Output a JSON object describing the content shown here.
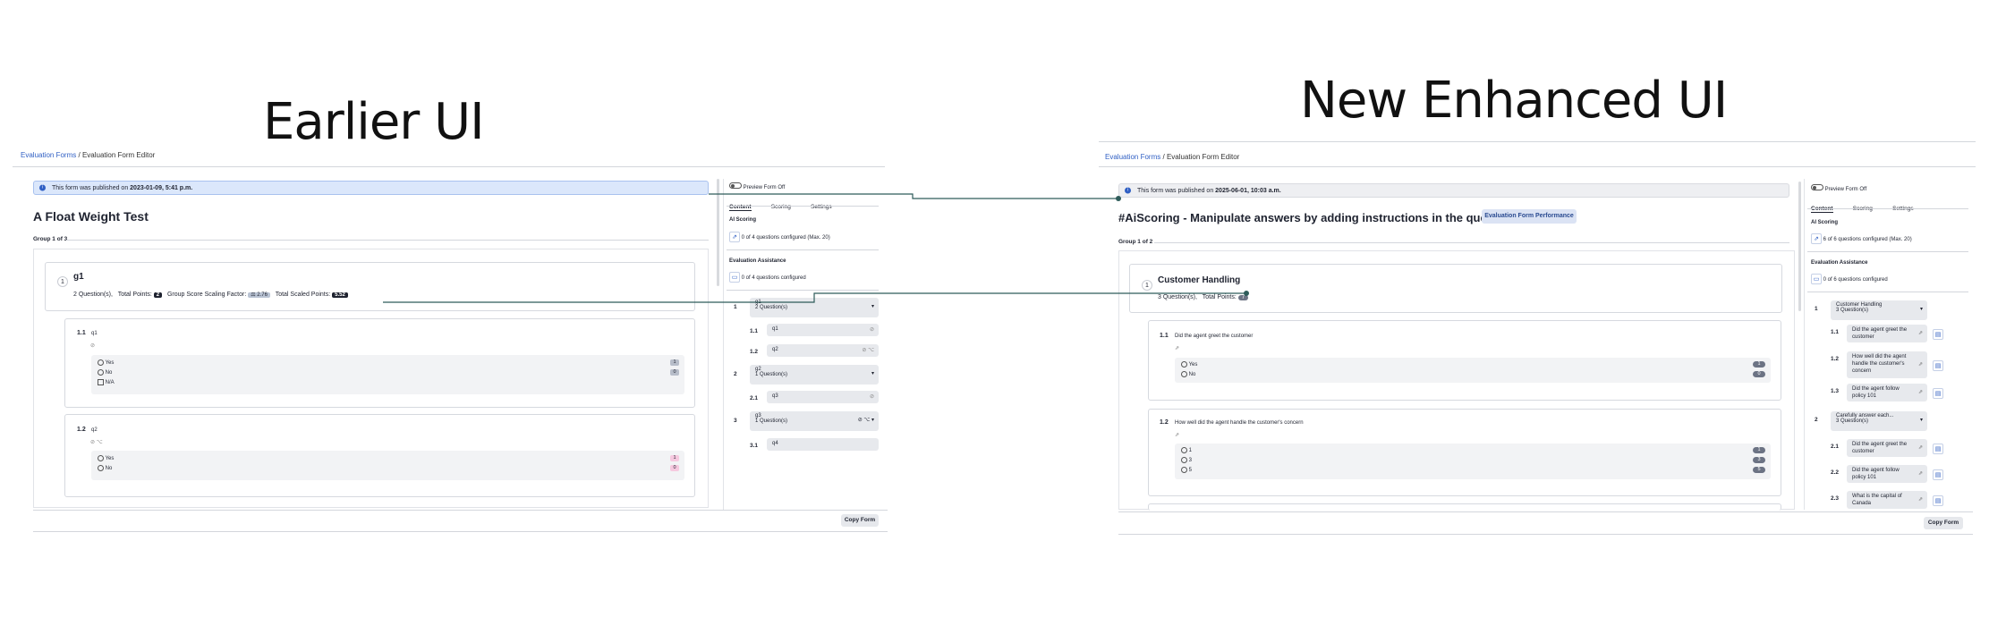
{
  "left": {
    "heading": "Earlier UI",
    "breadcrumb": {
      "root": "Evaluation Forms",
      "sep": "/",
      "current": "Evaluation Form Editor"
    },
    "banner": {
      "icon": "info-icon",
      "prefix": "This form was published on ",
      "date": "2023-01-09, 5:41 p.m."
    },
    "form_title": "A Float Weight Test",
    "group_label": "Group 1 of 3",
    "group": {
      "number": "1",
      "name": "g1",
      "questions_count": "2 Question(s),",
      "total_points_label": "Total Points:",
      "total_points": "2",
      "scaling_label": "Group Score Scaling Factor:",
      "scaling_value": "2.76",
      "scaled_label": "Total Scaled Points:",
      "scaled_value": "5.52"
    },
    "questions": [
      {
        "number": "1.1",
        "text": "q1",
        "options": [
          {
            "label": "Yes",
            "score": "1"
          },
          {
            "label": "No",
            "score": "0"
          }
        ],
        "na_label": "N/A"
      },
      {
        "number": "1.2",
        "text": "q2",
        "options": [
          {
            "label": "Yes",
            "score": "1"
          },
          {
            "label": "No",
            "score": "0"
          }
        ]
      }
    ],
    "sidebar": {
      "preview": "Preview Form Off",
      "tabs": [
        "Content",
        "Scoring",
        "Settings"
      ],
      "ai_scoring_title": "AI Scoring",
      "ai_scoring_text": "0 of 4 questions configured (Max. 20)",
      "eval_assist_title": "Evaluation Assistance",
      "eval_assist_text": "0 of 4 questions configured",
      "items": [
        {
          "num": "1",
          "title": "g1",
          "sub": "2 Question(s)",
          "children": [
            {
              "num": "1.1",
              "title": "q1"
            },
            {
              "num": "1.2",
              "title": "q2"
            }
          ]
        },
        {
          "num": "2",
          "title": "g2",
          "sub": "1 Question(s)",
          "children": [
            {
              "num": "2.1",
              "title": "q3"
            }
          ]
        },
        {
          "num": "3",
          "title": "g3",
          "sub": "1 Question(s)",
          "children": [
            {
              "num": "3.1",
              "title": "q4"
            }
          ]
        }
      ]
    },
    "copy_button": "Copy Form"
  },
  "right": {
    "heading": "New Enhanced UI",
    "breadcrumb": {
      "root": "Evaluation Forms",
      "sep": "/",
      "current": "Evaluation Form Editor"
    },
    "banner": {
      "icon": "info-icon",
      "prefix": "This form was published on ",
      "date": "2025-06-01, 10:03 a.m."
    },
    "form_title": "#AiScoring - Manipulate answers by adding instructions in the question",
    "performance_button": "Evaluation Form Performance",
    "group_label": "Group 1 of 2",
    "group": {
      "number": "1",
      "name": "Customer Handling",
      "questions_count": "3 Question(s),",
      "total_points_label": "Total Points:",
      "total_points": "7"
    },
    "questions": [
      {
        "number": "1.1",
        "text": "Did the agent greet the customer",
        "options": [
          {
            "label": "Yes",
            "score": "1"
          },
          {
            "label": "No",
            "score": "0"
          }
        ]
      },
      {
        "number": "1.2",
        "text": "How well did the agent handle the customer's concern",
        "options": [
          {
            "label": "1",
            "score": "1"
          },
          {
            "label": "3",
            "score": "3"
          },
          {
            "label": "5",
            "score": "5"
          }
        ]
      }
    ],
    "sidebar": {
      "preview": "Preview Form Off",
      "tabs": [
        "Content",
        "Scoring",
        "Settings"
      ],
      "ai_scoring_title": "AI Scoring",
      "ai_scoring_text": "6 of 6 questions configured (Max. 20)",
      "eval_assist_title": "Evaluation Assistance",
      "eval_assist_text": "0 of 6 questions configured",
      "items": [
        {
          "num": "1",
          "title": "Customer Handling",
          "sub": "3 Question(s)",
          "children": [
            {
              "num": "1.1",
              "title": "Did the agent greet the customer"
            },
            {
              "num": "1.2",
              "title": "How well did the agent handle the customer's concern"
            },
            {
              "num": "1.3",
              "title": "Did the agent follow policy 101"
            }
          ]
        },
        {
          "num": "2",
          "title": "Carefully answer each...",
          "sub": "3 Question(s)",
          "children": [
            {
              "num": "2.1",
              "title": "Did the agent greet the customer"
            },
            {
              "num": "2.2",
              "title": "Did the agent follow policy 101"
            },
            {
              "num": "2.3",
              "title": "What is the capital of Canada"
            }
          ]
        }
      ]
    },
    "copy_button": "Copy Form"
  },
  "colors": {
    "link": "#2f5fc4",
    "banner_bg": "#dbe7fb",
    "connector": "#2e5c5a"
  }
}
